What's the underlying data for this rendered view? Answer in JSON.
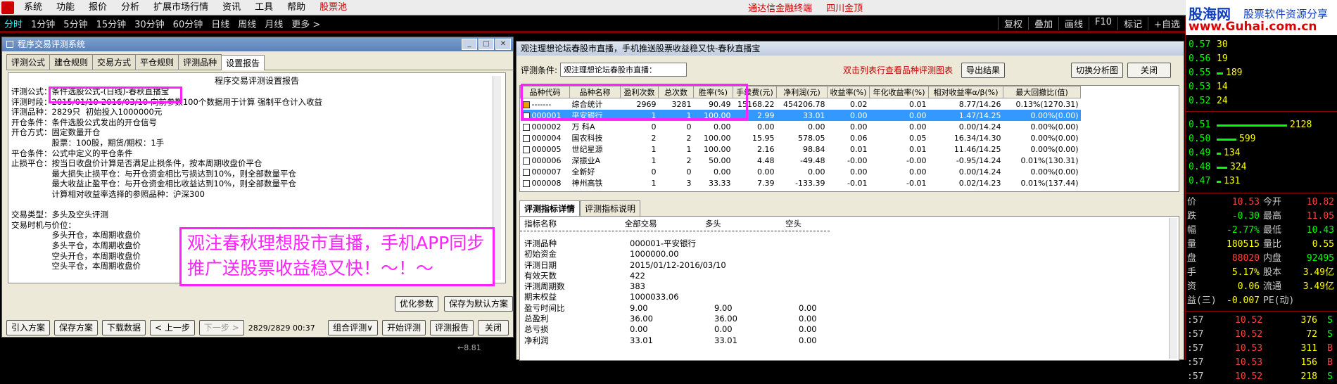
{
  "menubar": {
    "items": [
      "系统",
      "功能",
      "报价",
      "分析",
      "扩展市场行情",
      "资讯",
      "工具",
      "帮助",
      "股票池"
    ],
    "broker": "通达信金融终端",
    "broker2": "四川金顶"
  },
  "brand": {
    "name": "股海网",
    "slogan": "股票软件资源分享",
    "url": "www.Guhai.com.cn"
  },
  "periodbar": {
    "items": [
      "分时",
      "1分钟",
      "5分钟",
      "15分钟",
      "30分钟",
      "60分钟",
      "日线",
      "周线",
      "月线",
      "更多 >"
    ],
    "right": [
      "复权",
      "叠加",
      "画线",
      "F10",
      "标记",
      "+自选"
    ]
  },
  "leftwin": {
    "title": "程序交易评测系统",
    "tabs": [
      "评测公式",
      "建仓规则",
      "交易方式",
      "平仓规则",
      "评测品种",
      "设置报告"
    ],
    "report_title": "程序交易评测设置报告",
    "lines": [
      "评测公式：条件选股公式-(日线)-春秋直播宝",
      "评测时段：2015/01/10-2016/03/10 向前参数100个数据用于计算 强制平仓计入收益",
      "评测品种：2829只  初始投入1000000元",
      "开仓条件：条件选股公式发出的开仓信号",
      "开仓方式：固定数量开仓",
      "　　　　　股票：100股，期货/期权：1手",
      "平仓条件：公式中定义的平仓条件",
      "止损平仓：按当日收盘价计算是否满足止损条件，按本周期收盘价平仓",
      "　　　　　最大损失止损平仓：与开仓资金相比亏损达到10%，则全部数量平仓",
      "　　　　　最大收益止盈平仓：与开仓资金相比收益达到10%，则全部数量平仓",
      "　　　　　计算相对收益率选择的参照品种：沪深300",
      "",
      "交易类型：多头及空头评测",
      "交易时机与价位：",
      "　　　　　多头开仓，本周期收盘价",
      "　　　　　多头平仓，本周期收盘价",
      "　　　　　空头开仓，本周期收盘价",
      "　　　　　空头平仓，本周期收盘价"
    ],
    "ad_text": "观注春秋理想股市直播，手机APP同步推广送股票收益稳又快！～！～",
    "btn_optimize": "优化参数",
    "btn_save_default": "保存为默认方案",
    "bottom_buttons": [
      "引入方案",
      "保存方案",
      "下载数据",
      "< 上一步",
      "下一步 >"
    ],
    "progress": "2829/2829  00:37",
    "bottom_right_buttons": [
      "组合评测∨",
      "开始评测",
      "评测报告",
      "关闭"
    ]
  },
  "rightwin": {
    "title": "观注理想论坛春股市直播，手机推送股票收益稳又快-春秋直播宝",
    "cond_label": "评测条件:",
    "cond_value": "观注理想论坛春股市直播：",
    "hint": "双击列表行查看品种评测图表",
    "btn_export": "导出结果",
    "btn_switch": "切换分析图",
    "btn_close": "关闭",
    "columns": [
      "品种代码",
      "品种名称",
      "盈利次数",
      "总次数",
      "胜率(%)",
      "手续费(元)",
      "净利润(元)",
      "收益率(%)",
      "年化收益率(%)",
      "相对收益率α/β(%)",
      "最大回撤比(值)"
    ],
    "rows": [
      [
        "-------",
        "综合统计",
        "2969",
        "3281",
        "90.49",
        "15168.22",
        "454206.78",
        "0.02",
        "0.01",
        "8.77/14.26",
        "0.13%(1270.31)"
      ],
      [
        "000001",
        "平安银行",
        "1",
        "1",
        "100.00",
        "2.99",
        "33.01",
        "0.00",
        "0.00",
        "1.47/14.25",
        "0.00%(0.00)"
      ],
      [
        "000002",
        "万  科A",
        "0",
        "0",
        "0.00",
        "0.00",
        "0.00",
        "0.00",
        "0.00",
        "0.00/14.24",
        "0.00%(0.00)"
      ],
      [
        "000004",
        "国农科技",
        "2",
        "2",
        "100.00",
        "15.95",
        "578.05",
        "0.06",
        "0.05",
        "16.34/14.30",
        "0.00%(0.00)"
      ],
      [
        "000005",
        "世纪星源",
        "1",
        "1",
        "100.00",
        "2.16",
        "98.84",
        "0.01",
        "0.01",
        "11.46/14.25",
        "0.00%(0.00)"
      ],
      [
        "000006",
        "深振业A",
        "1",
        "2",
        "50.00",
        "4.48",
        "-49.48",
        "-0.00",
        "-0.00",
        "-0.95/14.24",
        "0.01%(130.31)"
      ],
      [
        "000007",
        "全新好",
        "0",
        "0",
        "0.00",
        "0.00",
        "0.00",
        "0.00",
        "0.00",
        "0.00/14.24",
        "0.00%(0.00)"
      ],
      [
        "000008",
        "神州高铁",
        "1",
        "3",
        "33.33",
        "7.39",
        "-133.39",
        "-0.01",
        "-0.01",
        "0.02/14.23",
        "0.01%(137.44)"
      ]
    ],
    "bottom_tabs": [
      "评测指标详情",
      "评测指标说明"
    ],
    "detail_headers": [
      "指标名称",
      "全部交易",
      "多头",
      "空头"
    ],
    "details": [
      [
        "评测品种",
        "000001-平安银行",
        "",
        ""
      ],
      [
        "初始资金",
        "1000000.00",
        "",
        ""
      ],
      [
        "评测日期",
        "2015/01/12-2016/03/10",
        "",
        ""
      ],
      [
        "有效天数",
        "422",
        "",
        ""
      ],
      [
        "评测周期数",
        "383",
        "",
        ""
      ],
      [
        "期末权益",
        "1000033.06",
        "",
        ""
      ],
      [
        "盈亏时间比",
        "9.00",
        "9.00",
        "0.00"
      ],
      [
        "总盈利",
        "36.00",
        "36.00",
        "0.00"
      ],
      [
        "总亏损",
        "0.00",
        "0.00",
        "0.00"
      ],
      [
        "净利润",
        "33.01",
        "33.01",
        "0.00"
      ]
    ]
  },
  "quote": {
    "orderbook": [
      {
        "price": "0.57",
        "vol": "30",
        "bar": 0
      },
      {
        "price": "0.56",
        "vol": "19",
        "bar": 0
      },
      {
        "price": "0.55",
        "vol": "189",
        "bar": 0.09
      },
      {
        "price": "0.53",
        "vol": "14",
        "bar": 0
      },
      {
        "price": "0.52",
        "vol": "24",
        "bar": 0
      },
      {
        "price": "0.51",
        "vol": "2128",
        "bar": 1.0
      },
      {
        "price": "0.50",
        "vol": "599",
        "bar": 0.28
      },
      {
        "price": "0.49",
        "vol": "134",
        "bar": 0.06
      },
      {
        "price": "0.48",
        "vol": "324",
        "bar": 0.15
      },
      {
        "price": "0.47",
        "vol": "131",
        "bar": 0.06
      }
    ],
    "stats": [
      {
        "l": "价",
        "v": "10.53",
        "l2": "今开",
        "v2": "10.82",
        "c1": "#ff4040",
        "c2": "#ff4040"
      },
      {
        "l": "跌",
        "v": "-0.30",
        "l2": "最高",
        "v2": "11.05",
        "c1": "#00ff00",
        "c2": "#ff4040"
      },
      {
        "l": "幅",
        "v": "-2.77%",
        "l2": "最低",
        "v2": "10.43",
        "c1": "#00ff00",
        "c2": "#00ff00"
      },
      {
        "l": "量",
        "v": "180515",
        "l2": "量比",
        "v2": "0.55",
        "c1": "#ffff00",
        "c2": "#ffff00"
      },
      {
        "l": "盘",
        "v": "88020",
        "l2": "内盘",
        "v2": "92495",
        "c1": "#ff4040",
        "c2": "#00ff00"
      },
      {
        "l": "手",
        "v": "5.17%",
        "l2": "股本",
        "v2": "3.49亿",
        "c1": "#ffff00",
        "c2": "#ffff00"
      },
      {
        "l": "资",
        "v": "0.06",
        "l2": "流通",
        "v2": "3.49亿",
        "c1": "#ffff00",
        "c2": "#ffff00"
      },
      {
        "l": "益(三)",
        "v": "-0.007",
        "l2": "PE(动)",
        "v2": "",
        "c1": "#ffff00",
        "c2": "#ffff00"
      }
    ],
    "ticks": [
      {
        "t": ":57",
        "p": "10.52",
        "v": "376",
        "s": "S",
        "sc": "#00ff00"
      },
      {
        "t": ":57",
        "p": "10.52",
        "v": "72",
        "s": "S",
        "sc": "#00ff00"
      },
      {
        "t": ":57",
        "p": "10.53",
        "v": "311",
        "s": "B",
        "sc": "#ff4040"
      },
      {
        "t": ":57",
        "p": "10.53",
        "v": "156",
        "s": "B",
        "sc": "#ff4040"
      },
      {
        "t": ":57",
        "p": "10.52",
        "v": "218",
        "s": "S",
        "sc": "#00ff00"
      }
    ]
  },
  "bottomstrip": {
    "value": "←8.81"
  },
  "colors": {
    "accent_magenta": "#ff22ff",
    "up": "#ff4040",
    "down": "#00ff00",
    "highlight_row": "#3399ff"
  }
}
